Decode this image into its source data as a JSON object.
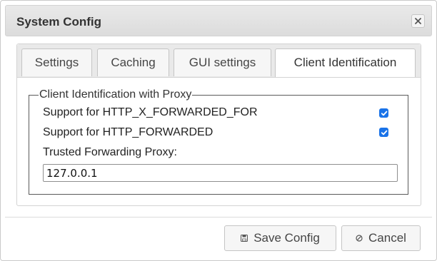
{
  "dialog": {
    "title": "System Config",
    "close_icon": "close-icon"
  },
  "tabs": [
    {
      "label": "Settings",
      "active": false
    },
    {
      "label": "Caching",
      "active": false
    },
    {
      "label": "GUI settings",
      "active": false
    },
    {
      "label": "Client Identification",
      "active": true
    }
  ],
  "client_identification": {
    "legend": "Client Identification with Proxy",
    "x_forwarded_for_label": "Support for HTTP_X_FORWARDED_FOR",
    "x_forwarded_for_checked": true,
    "forwarded_label": "Support for HTTP_FORWARDED",
    "forwarded_checked": true,
    "trusted_proxy_label": "Trusted Forwarding Proxy:",
    "trusted_proxy_value": "127.0.0.1"
  },
  "buttons": {
    "save_label": "Save Config",
    "save_icon": "disk-icon",
    "cancel_label": "Cancel",
    "cancel_icon": "cancel-icon"
  },
  "colors": {
    "checkbox_accent": "#1a73e8"
  }
}
